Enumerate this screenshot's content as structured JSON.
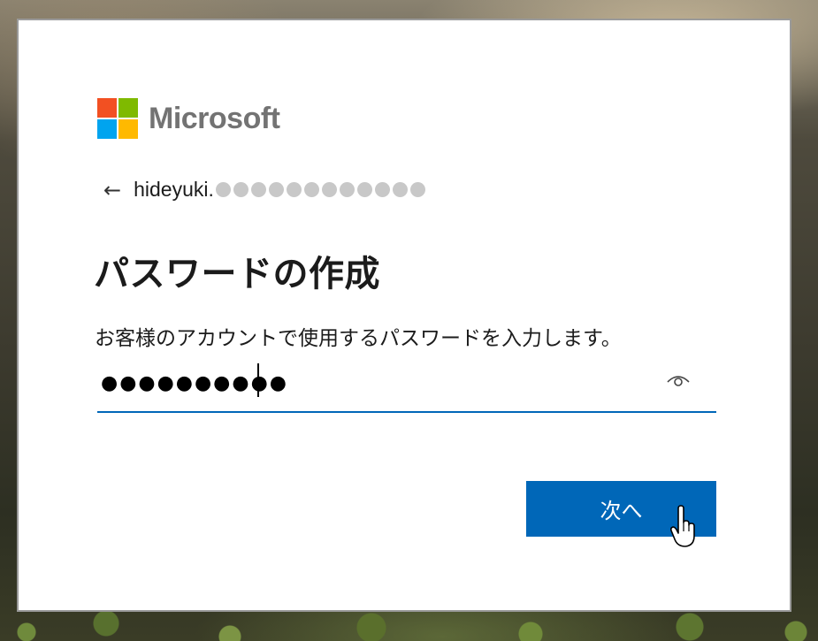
{
  "logo": {
    "text": "Microsoft",
    "colors": [
      "#f25022",
      "#7fba00",
      "#00a4ef",
      "#ffb900"
    ]
  },
  "identity": {
    "back_icon": "back-arrow-icon",
    "email_visible": "hideyuki.",
    "email_masked_count": 12
  },
  "title": "パスワードの作成",
  "description": "お客様のアカウントで使用するパスワードを入力します。",
  "password_field": {
    "value": "●●●●●●●●●●",
    "reveal_icon": "eye-icon"
  },
  "next_button": {
    "label": "次へ"
  },
  "theme": {
    "accent": "#0067b8",
    "text": "#1b1b1b"
  }
}
